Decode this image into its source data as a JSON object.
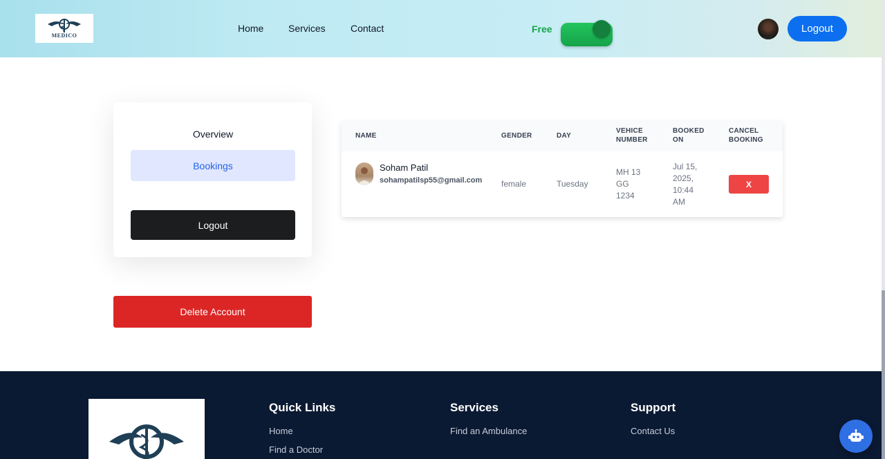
{
  "header": {
    "logo_text": "MEDICO",
    "nav": [
      {
        "label": "Home"
      },
      {
        "label": "Services"
      },
      {
        "label": "Contact"
      }
    ],
    "plan_label": "Free",
    "plan_toggle_on": true,
    "logout_label": "Logout",
    "accent_color": "#0b6ff0"
  },
  "sidebar": {
    "overview_label": "Overview",
    "bookings_label": "Bookings",
    "logout_label": "Logout",
    "delete_label": "Delete Account"
  },
  "bookings_table": {
    "columns": {
      "name": "NAME",
      "gender": "GENDER",
      "day": "DAY",
      "vehicle_1": "VEHICE",
      "vehicle_2": "NUMBER",
      "booked_1": "BOOKED",
      "booked_2": "ON",
      "cancel_1": "CANCEL",
      "cancel_2": "BOOKING"
    },
    "rows": [
      {
        "name": "Soham Patil",
        "email": "sohampatilsp55@gmail.com",
        "gender": "female",
        "day": "Tuesday",
        "vehicle_lines": [
          "MH 13",
          "GG",
          "1234"
        ],
        "booked_lines": [
          "Jul 15,",
          "2025,",
          "10:44",
          "AM"
        ],
        "cancel_label": "X"
      }
    ]
  },
  "footer": {
    "quick_links_title": "Quick Links",
    "quick_links": [
      "Home",
      "Find a Doctor"
    ],
    "services_title": "Services",
    "services_links": [
      "Find an Ambulance"
    ],
    "support_title": "Support",
    "support_links": [
      "Contact Us"
    ]
  },
  "icons": {
    "logo": "caduceus-logo-icon",
    "chatbot": "robot-icon"
  }
}
